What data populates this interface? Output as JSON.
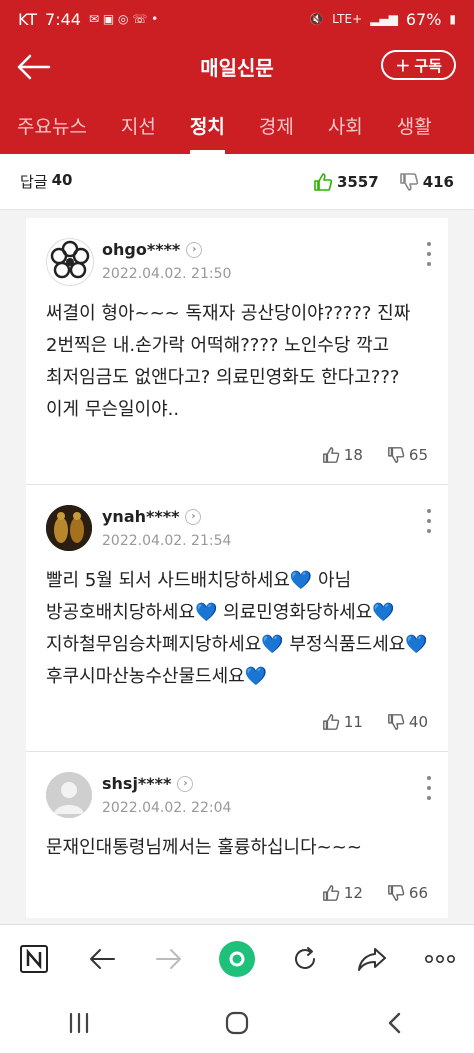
{
  "status": {
    "carrier": "KT",
    "time": "7:44",
    "battery": "67%",
    "network": "LTE+"
  },
  "header": {
    "title": "매일신문",
    "subscribe_label": "구독"
  },
  "tabs": [
    {
      "label": "주요뉴스",
      "active": false
    },
    {
      "label": "지선",
      "active": false
    },
    {
      "label": "정치",
      "active": true
    },
    {
      "label": "경제",
      "active": false
    },
    {
      "label": "사회",
      "active": false
    },
    {
      "label": "생활",
      "active": false
    }
  ],
  "summary": {
    "label": "답글",
    "count": "40",
    "likes": "3557",
    "dislikes": "416"
  },
  "comments": [
    {
      "user": "ohgo****",
      "date": "2022.04.02. 21:50",
      "text": "써결이 형아~~~ 독재자 공산당이야????? 진짜 2번찍은 내.손가락 어떡해???? 노인수당 깍고 최저임금도 없앤다고? 의료민영화도 한다고??? 이게 무슨일이야..",
      "likes": "18",
      "dislikes": "65"
    },
    {
      "user": "ynah****",
      "date": "2022.04.02. 21:54",
      "text": "빨리 5월 되서 사드배치당하세요💙 아님 방공호배치당하세요💙 의료민영화당하세요💙지하철무임승차폐지당하세요💙 부정식품드세요💙 후쿠시마산농수산물드세요💙",
      "likes": "11",
      "dislikes": "40"
    },
    {
      "user": "shsj****",
      "date": "2022.04.02. 22:04",
      "text": "문재인대통령님께서는 훌륭하십니다~~~",
      "likes": "12",
      "dislikes": "66"
    }
  ],
  "colors": {
    "brand": "#cc1f24",
    "like": "#2db400",
    "heart": "#1e90ff"
  },
  "icons": [
    "back-arrow-icon",
    "plus-icon",
    "thumbs-up-icon",
    "thumbs-down-icon",
    "more-vert-icon",
    "chevron-right-icon",
    "naver-n-icon",
    "nav-back-icon",
    "nav-forward-icon",
    "green-home-icon",
    "refresh-icon",
    "share-icon",
    "more-horiz-icon"
  ]
}
